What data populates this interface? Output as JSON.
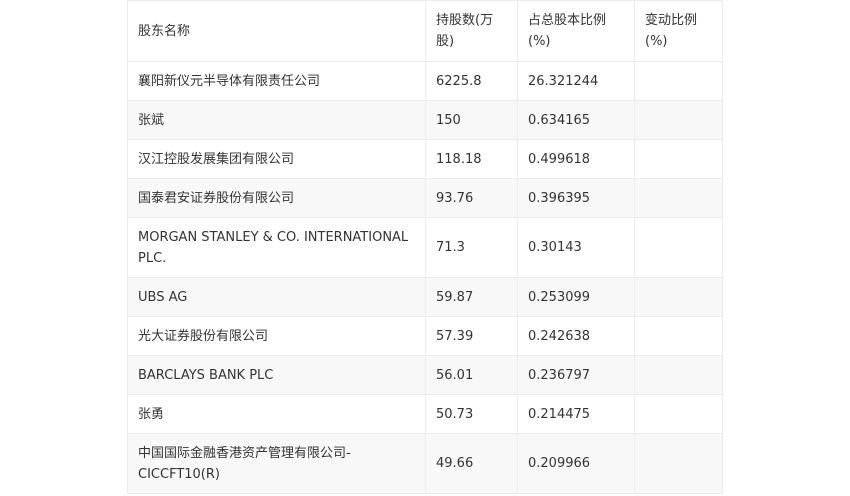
{
  "table": {
    "headers": [
      "股东名称",
      "持股数(万股)",
      "占总股本比例(%)",
      "变动比例(%)"
    ],
    "rows": [
      {
        "name": "襄阳新仪元半导体有限责任公司",
        "shares": "6225.8",
        "ratio": "26.321244",
        "change": ""
      },
      {
        "name": "张斌",
        "shares": "150",
        "ratio": "0.634165",
        "change": ""
      },
      {
        "name": "汉江控股发展集团有限公司",
        "shares": "118.18",
        "ratio": "0.499618",
        "change": ""
      },
      {
        "name": "国泰君安证券股份有限公司",
        "shares": "93.76",
        "ratio": "0.396395",
        "change": ""
      },
      {
        "name": "MORGAN STANLEY & CO. INTERNATIONAL PLC.",
        "shares": "71.3",
        "ratio": "0.30143",
        "change": ""
      },
      {
        "name": "UBS AG",
        "shares": "59.87",
        "ratio": "0.253099",
        "change": ""
      },
      {
        "name": "光大证券股份有限公司",
        "shares": "57.39",
        "ratio": "0.242638",
        "change": ""
      },
      {
        "name": "BARCLAYS BANK PLC",
        "shares": "56.01",
        "ratio": "0.236797",
        "change": ""
      },
      {
        "name": "张勇",
        "shares": "50.73",
        "ratio": "0.214475",
        "change": ""
      },
      {
        "name": "中国国际金融香港资产管理有限公司-CICCFT10(R)",
        "shares": "49.66",
        "ratio": "0.209966",
        "change": ""
      }
    ]
  }
}
